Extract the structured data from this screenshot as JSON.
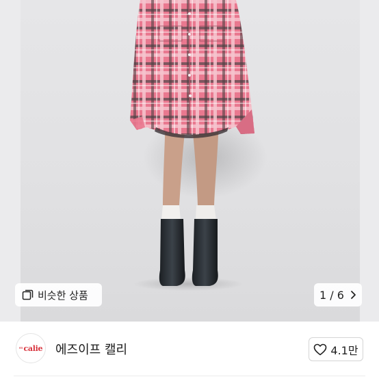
{
  "product_image": {
    "similar_button": {
      "label": "비슷한 상품",
      "icon": "similar-items-icon"
    },
    "pagination": {
      "text": "1 / 6",
      "icon": "chevron-right-icon"
    }
  },
  "seller": {
    "avatar_logo": {
      "small_text": "es",
      "main_text": "calie"
    },
    "name": "에즈이프 캘리"
  },
  "like": {
    "count": "4.1만",
    "icon": "heart-outline-icon"
  }
}
